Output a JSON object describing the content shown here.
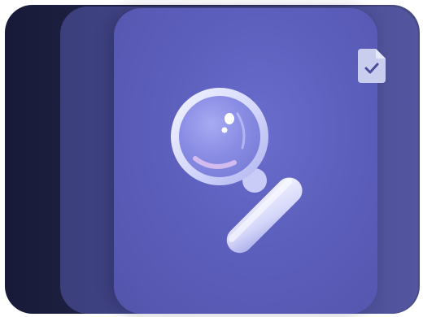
{
  "scene": {
    "icons": [
      "magnifying-glass-icon",
      "document-check-icon"
    ],
    "colors": {
      "back_card": "#1f2144",
      "mid_card": "#474a8c",
      "front_card": "#5d5fbd",
      "badge_fill": "#c9cdee",
      "badge_check": "#4a4d9a",
      "lens_rim": "#dfe3ff",
      "lens_glass": "#8b8fe6",
      "handle": "#e4e6ff"
    }
  }
}
